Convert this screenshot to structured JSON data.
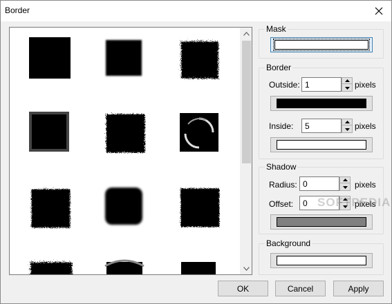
{
  "window": {
    "title": "Border"
  },
  "groups": {
    "mask": {
      "label": "Mask",
      "color": "#ffffff"
    },
    "border": {
      "label": "Border",
      "outside_label": "Outside:",
      "outside_value": "1",
      "outside_unit": "pixels",
      "outside_color": "#000000",
      "inside_label": "Inside:",
      "inside_value": "5",
      "inside_unit": "pixels",
      "inside_color": "#ffffff"
    },
    "shadow": {
      "label": "Shadow",
      "radius_label": "Radius:",
      "radius_value": "0",
      "radius_unit": "pixels",
      "offset_label": "Offset:",
      "offset_value": "0",
      "offset_unit": "pixels",
      "color": "#808080"
    },
    "background": {
      "label": "Background",
      "color": "#ffffff"
    }
  },
  "buttons": {
    "ok": "OK",
    "cancel": "Cancel",
    "apply": "Apply"
  },
  "watermark": "SOFTPEDIA",
  "gallery": {
    "thumbnails": [
      "square-sharp",
      "square-soft",
      "square-spray",
      "square-blur-edge",
      "square-rough",
      "square-swirl",
      "square-noise",
      "square-rounded-blur",
      "square-spray-dense",
      "square-torn",
      "square-arc",
      "square-sharp-small"
    ]
  }
}
